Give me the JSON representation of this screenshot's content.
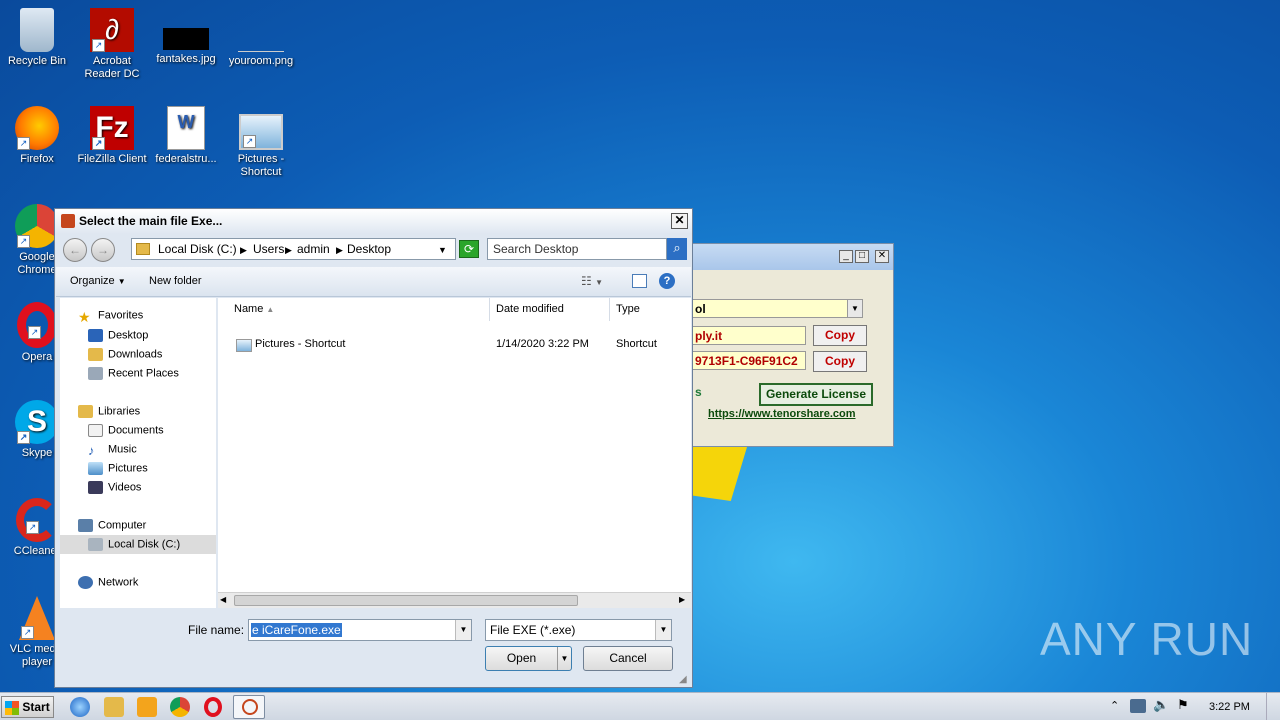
{
  "desktop": {
    "icons": [
      {
        "label": "Recycle Bin"
      },
      {
        "label": "Acrobat Reader DC"
      },
      {
        "label": "fantakes.jpg"
      },
      {
        "label": "youroom.png"
      },
      {
        "label": "Firefox"
      },
      {
        "label": "FileZilla Client"
      },
      {
        "label": "federalstru..."
      },
      {
        "label": "Pictures - Shortcut"
      },
      {
        "label": "Google Chrome"
      },
      {
        "label": "Opera"
      },
      {
        "label": "Skype"
      },
      {
        "label": "CCleaner"
      },
      {
        "label": "VLC media player"
      }
    ],
    "watermark": "ANY RUN"
  },
  "bg_window": {
    "dropdown_value": "ol",
    "field1_value": "ply.it",
    "field2_value": "9713F1-C96F91C2",
    "copy_label": "Copy",
    "generate_label": "Generate License",
    "partial_text": "s",
    "link": "https://www.tenorshare.com"
  },
  "dialog": {
    "title": "Select the main file Exe...",
    "breadcrumb": [
      "Local Disk (C:)",
      "Users",
      "admin",
      "Desktop"
    ],
    "search_placeholder": "Search Desktop",
    "organize_label": "Organize",
    "new_folder_label": "New folder",
    "nav": {
      "favorites": "Favorites",
      "desktop": "Desktop",
      "downloads": "Downloads",
      "recent": "Recent Places",
      "libraries": "Libraries",
      "documents": "Documents",
      "music": "Music",
      "pictures": "Pictures",
      "videos": "Videos",
      "computer": "Computer",
      "local_disk": "Local Disk (C:)",
      "network": "Network"
    },
    "columns": {
      "name": "Name",
      "date": "Date modified",
      "type": "Type"
    },
    "files": [
      {
        "name": "Pictures - Shortcut",
        "date": "1/14/2020 3:22 PM",
        "type": "Shortcut"
      }
    ],
    "file_name_label": "File name:",
    "file_name_value": "e iCareFone.exe",
    "file_type_value": "File EXE (*.exe)",
    "open_label": "Open",
    "cancel_label": "Cancel"
  },
  "taskbar": {
    "start_label": "Start",
    "clock": "3:22 PM"
  }
}
